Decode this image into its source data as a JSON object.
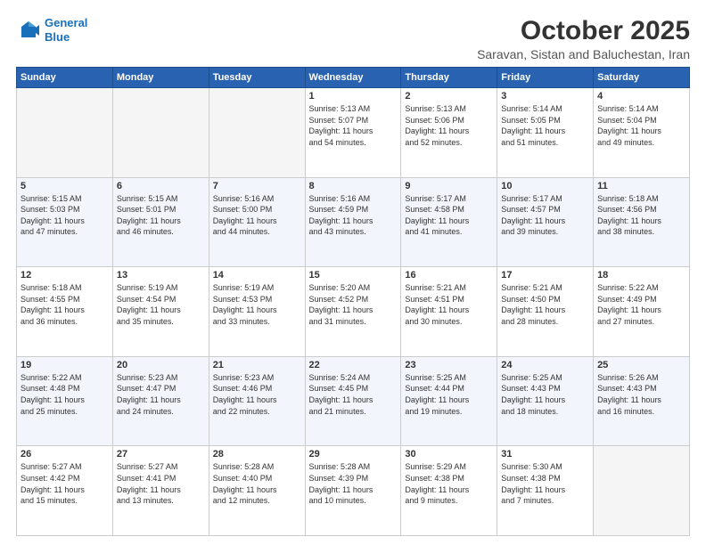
{
  "header": {
    "logo_line1": "General",
    "logo_line2": "Blue",
    "month_title": "October 2025",
    "subtitle": "Saravan, Sistan and Baluchestan, Iran"
  },
  "weekdays": [
    "Sunday",
    "Monday",
    "Tuesday",
    "Wednesday",
    "Thursday",
    "Friday",
    "Saturday"
  ],
  "weeks": [
    [
      {
        "day": "",
        "content": ""
      },
      {
        "day": "",
        "content": ""
      },
      {
        "day": "",
        "content": ""
      },
      {
        "day": "1",
        "content": "Sunrise: 5:13 AM\nSunset: 5:07 PM\nDaylight: 11 hours\nand 54 minutes."
      },
      {
        "day": "2",
        "content": "Sunrise: 5:13 AM\nSunset: 5:06 PM\nDaylight: 11 hours\nand 52 minutes."
      },
      {
        "day": "3",
        "content": "Sunrise: 5:14 AM\nSunset: 5:05 PM\nDaylight: 11 hours\nand 51 minutes."
      },
      {
        "day": "4",
        "content": "Sunrise: 5:14 AM\nSunset: 5:04 PM\nDaylight: 11 hours\nand 49 minutes."
      }
    ],
    [
      {
        "day": "5",
        "content": "Sunrise: 5:15 AM\nSunset: 5:03 PM\nDaylight: 11 hours\nand 47 minutes."
      },
      {
        "day": "6",
        "content": "Sunrise: 5:15 AM\nSunset: 5:01 PM\nDaylight: 11 hours\nand 46 minutes."
      },
      {
        "day": "7",
        "content": "Sunrise: 5:16 AM\nSunset: 5:00 PM\nDaylight: 11 hours\nand 44 minutes."
      },
      {
        "day": "8",
        "content": "Sunrise: 5:16 AM\nSunset: 4:59 PM\nDaylight: 11 hours\nand 43 minutes."
      },
      {
        "day": "9",
        "content": "Sunrise: 5:17 AM\nSunset: 4:58 PM\nDaylight: 11 hours\nand 41 minutes."
      },
      {
        "day": "10",
        "content": "Sunrise: 5:17 AM\nSunset: 4:57 PM\nDaylight: 11 hours\nand 39 minutes."
      },
      {
        "day": "11",
        "content": "Sunrise: 5:18 AM\nSunset: 4:56 PM\nDaylight: 11 hours\nand 38 minutes."
      }
    ],
    [
      {
        "day": "12",
        "content": "Sunrise: 5:18 AM\nSunset: 4:55 PM\nDaylight: 11 hours\nand 36 minutes."
      },
      {
        "day": "13",
        "content": "Sunrise: 5:19 AM\nSunset: 4:54 PM\nDaylight: 11 hours\nand 35 minutes."
      },
      {
        "day": "14",
        "content": "Sunrise: 5:19 AM\nSunset: 4:53 PM\nDaylight: 11 hours\nand 33 minutes."
      },
      {
        "day": "15",
        "content": "Sunrise: 5:20 AM\nSunset: 4:52 PM\nDaylight: 11 hours\nand 31 minutes."
      },
      {
        "day": "16",
        "content": "Sunrise: 5:21 AM\nSunset: 4:51 PM\nDaylight: 11 hours\nand 30 minutes."
      },
      {
        "day": "17",
        "content": "Sunrise: 5:21 AM\nSunset: 4:50 PM\nDaylight: 11 hours\nand 28 minutes."
      },
      {
        "day": "18",
        "content": "Sunrise: 5:22 AM\nSunset: 4:49 PM\nDaylight: 11 hours\nand 27 minutes."
      }
    ],
    [
      {
        "day": "19",
        "content": "Sunrise: 5:22 AM\nSunset: 4:48 PM\nDaylight: 11 hours\nand 25 minutes."
      },
      {
        "day": "20",
        "content": "Sunrise: 5:23 AM\nSunset: 4:47 PM\nDaylight: 11 hours\nand 24 minutes."
      },
      {
        "day": "21",
        "content": "Sunrise: 5:23 AM\nSunset: 4:46 PM\nDaylight: 11 hours\nand 22 minutes."
      },
      {
        "day": "22",
        "content": "Sunrise: 5:24 AM\nSunset: 4:45 PM\nDaylight: 11 hours\nand 21 minutes."
      },
      {
        "day": "23",
        "content": "Sunrise: 5:25 AM\nSunset: 4:44 PM\nDaylight: 11 hours\nand 19 minutes."
      },
      {
        "day": "24",
        "content": "Sunrise: 5:25 AM\nSunset: 4:43 PM\nDaylight: 11 hours\nand 18 minutes."
      },
      {
        "day": "25",
        "content": "Sunrise: 5:26 AM\nSunset: 4:43 PM\nDaylight: 11 hours\nand 16 minutes."
      }
    ],
    [
      {
        "day": "26",
        "content": "Sunrise: 5:27 AM\nSunset: 4:42 PM\nDaylight: 11 hours\nand 15 minutes."
      },
      {
        "day": "27",
        "content": "Sunrise: 5:27 AM\nSunset: 4:41 PM\nDaylight: 11 hours\nand 13 minutes."
      },
      {
        "day": "28",
        "content": "Sunrise: 5:28 AM\nSunset: 4:40 PM\nDaylight: 11 hours\nand 12 minutes."
      },
      {
        "day": "29",
        "content": "Sunrise: 5:28 AM\nSunset: 4:39 PM\nDaylight: 11 hours\nand 10 minutes."
      },
      {
        "day": "30",
        "content": "Sunrise: 5:29 AM\nSunset: 4:38 PM\nDaylight: 11 hours\nand 9 minutes."
      },
      {
        "day": "31",
        "content": "Sunrise: 5:30 AM\nSunset: 4:38 PM\nDaylight: 11 hours\nand 7 minutes."
      },
      {
        "day": "",
        "content": ""
      }
    ]
  ]
}
